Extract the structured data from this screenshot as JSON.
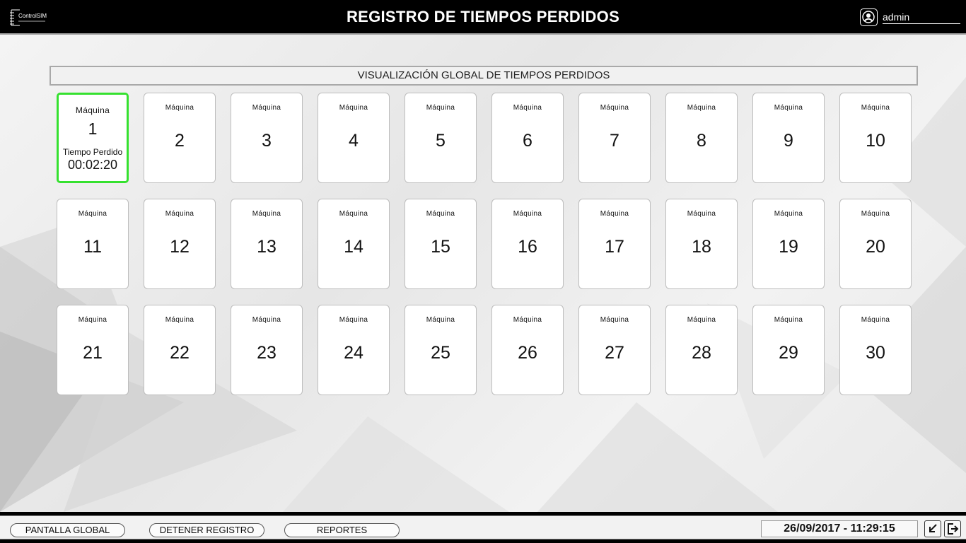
{
  "header": {
    "logo_text": "ControlSIM",
    "title": "REGISTRO DE TIEMPOS PERDIDOS",
    "user": "admin"
  },
  "section": {
    "title": "VISUALIZACIÓN GLOBAL DE TIEMPOS PERDIDOS"
  },
  "machine_label": "Máquina",
  "lost_time_label": "Tiempo Perdido",
  "machines": [
    {
      "label": "Máquina",
      "number": "1",
      "lost_time": "00:02:20",
      "active": true
    },
    {
      "label": "Máquina",
      "number": "2"
    },
    {
      "label": "Máquina",
      "number": "3"
    },
    {
      "label": "Máquina",
      "number": "4"
    },
    {
      "label": "Máquina",
      "number": "5"
    },
    {
      "label": "Máquina",
      "number": "6"
    },
    {
      "label": "Máquina",
      "number": "7"
    },
    {
      "label": "Máquina",
      "number": "8"
    },
    {
      "label": "Máquina",
      "number": "9"
    },
    {
      "label": "Máquina",
      "number": "10"
    },
    {
      "label": "Máquina",
      "number": "11"
    },
    {
      "label": "Máquina",
      "number": "12"
    },
    {
      "label": "Máquina",
      "number": "13"
    },
    {
      "label": "Máquina",
      "number": "14"
    },
    {
      "label": "Máquina",
      "number": "15"
    },
    {
      "label": "Máquina",
      "number": "16"
    },
    {
      "label": "Máquina",
      "number": "17"
    },
    {
      "label": "Máquina",
      "number": "18"
    },
    {
      "label": "Máquina",
      "number": "19"
    },
    {
      "label": "Máquina",
      "number": "20"
    },
    {
      "label": "Máquina",
      "number": "21"
    },
    {
      "label": "Máquina",
      "number": "22"
    },
    {
      "label": "Máquina",
      "number": "23"
    },
    {
      "label": "Máquina",
      "number": "24"
    },
    {
      "label": "Máquina",
      "number": "25"
    },
    {
      "label": "Máquina",
      "number": "26"
    },
    {
      "label": "Máquina",
      "number": "27"
    },
    {
      "label": "Máquina",
      "number": "28"
    },
    {
      "label": "Máquina",
      "number": "29"
    },
    {
      "label": "Máquina",
      "number": "30"
    }
  ],
  "footer": {
    "buttons": [
      "PANTALLA GLOBAL",
      "DETENER REGISTRO",
      "REPORTES"
    ],
    "datetime": "26/09/2017 - 11:29:15",
    "icons": [
      "minimize-icon",
      "exit-icon"
    ]
  },
  "colors": {
    "header_bg": "#000000",
    "active_border": "#35e12f",
    "card_bg": "#ffffff"
  }
}
